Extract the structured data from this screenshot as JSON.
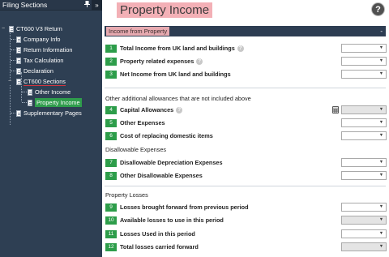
{
  "sidebar": {
    "header": "Filing Sections",
    "pin_glyph": "⬚",
    "collapse_glyph": "»",
    "items": [
      {
        "label": "CT600 V3 Return"
      },
      {
        "label": "Company Info"
      },
      {
        "label": "Return Information"
      },
      {
        "label": "Tax Calculation"
      },
      {
        "label": "Declaration"
      },
      {
        "label": "CT600 Sections"
      },
      {
        "label": "Other Income"
      },
      {
        "label": "Property Income"
      },
      {
        "label": "Supplementary Pages"
      }
    ]
  },
  "main": {
    "title": "Property Income",
    "help_glyph": "?",
    "section_label": "Income from Property",
    "section_toggle": "-",
    "heading_other": "Other additional allowances that are not included above",
    "heading_disallowable": "Disallowable Expenses",
    "heading_losses": "Property Losses",
    "fields": [
      {
        "num": "1",
        "label": "Total Income from UK land and buildings",
        "help": true,
        "disabled": false
      },
      {
        "num": "2",
        "label": "Property related expenses",
        "help": true,
        "disabled": false
      },
      {
        "num": "3",
        "label": "Net Income from UK land and buildings",
        "help": false,
        "disabled": false
      },
      {
        "num": "4",
        "label": "Capital Allowances",
        "help": true,
        "disabled": true,
        "calc": true
      },
      {
        "num": "5",
        "label": "Other Expenses",
        "help": false,
        "disabled": false
      },
      {
        "num": "6",
        "label": "Cost of replacing domestic items",
        "help": false,
        "disabled": false
      },
      {
        "num": "7",
        "label": "Disallowable Depreciation Expenses",
        "help": false,
        "disabled": false
      },
      {
        "num": "8",
        "label": "Other Disallowable Expenses",
        "help": false,
        "disabled": false
      },
      {
        "num": "9",
        "label": "Losses brought forward from previous period",
        "help": false,
        "disabled": false
      },
      {
        "num": "10",
        "label": "Available losses to use in this period",
        "help": false,
        "disabled": true
      },
      {
        "num": "11",
        "label": "Losses Used in this period",
        "help": false,
        "disabled": false
      },
      {
        "num": "12",
        "label": "Total losses carried forward",
        "help": false,
        "disabled": true
      }
    ],
    "help_glyph_small": "?",
    "dropdown_arrow": "▼"
  },
  "colors": {
    "sidebar_bg": "#2e3f53",
    "badge_green": "#2d9d4a",
    "title_highlight": "#f3b0b6",
    "underline_red": "#d0353f"
  }
}
